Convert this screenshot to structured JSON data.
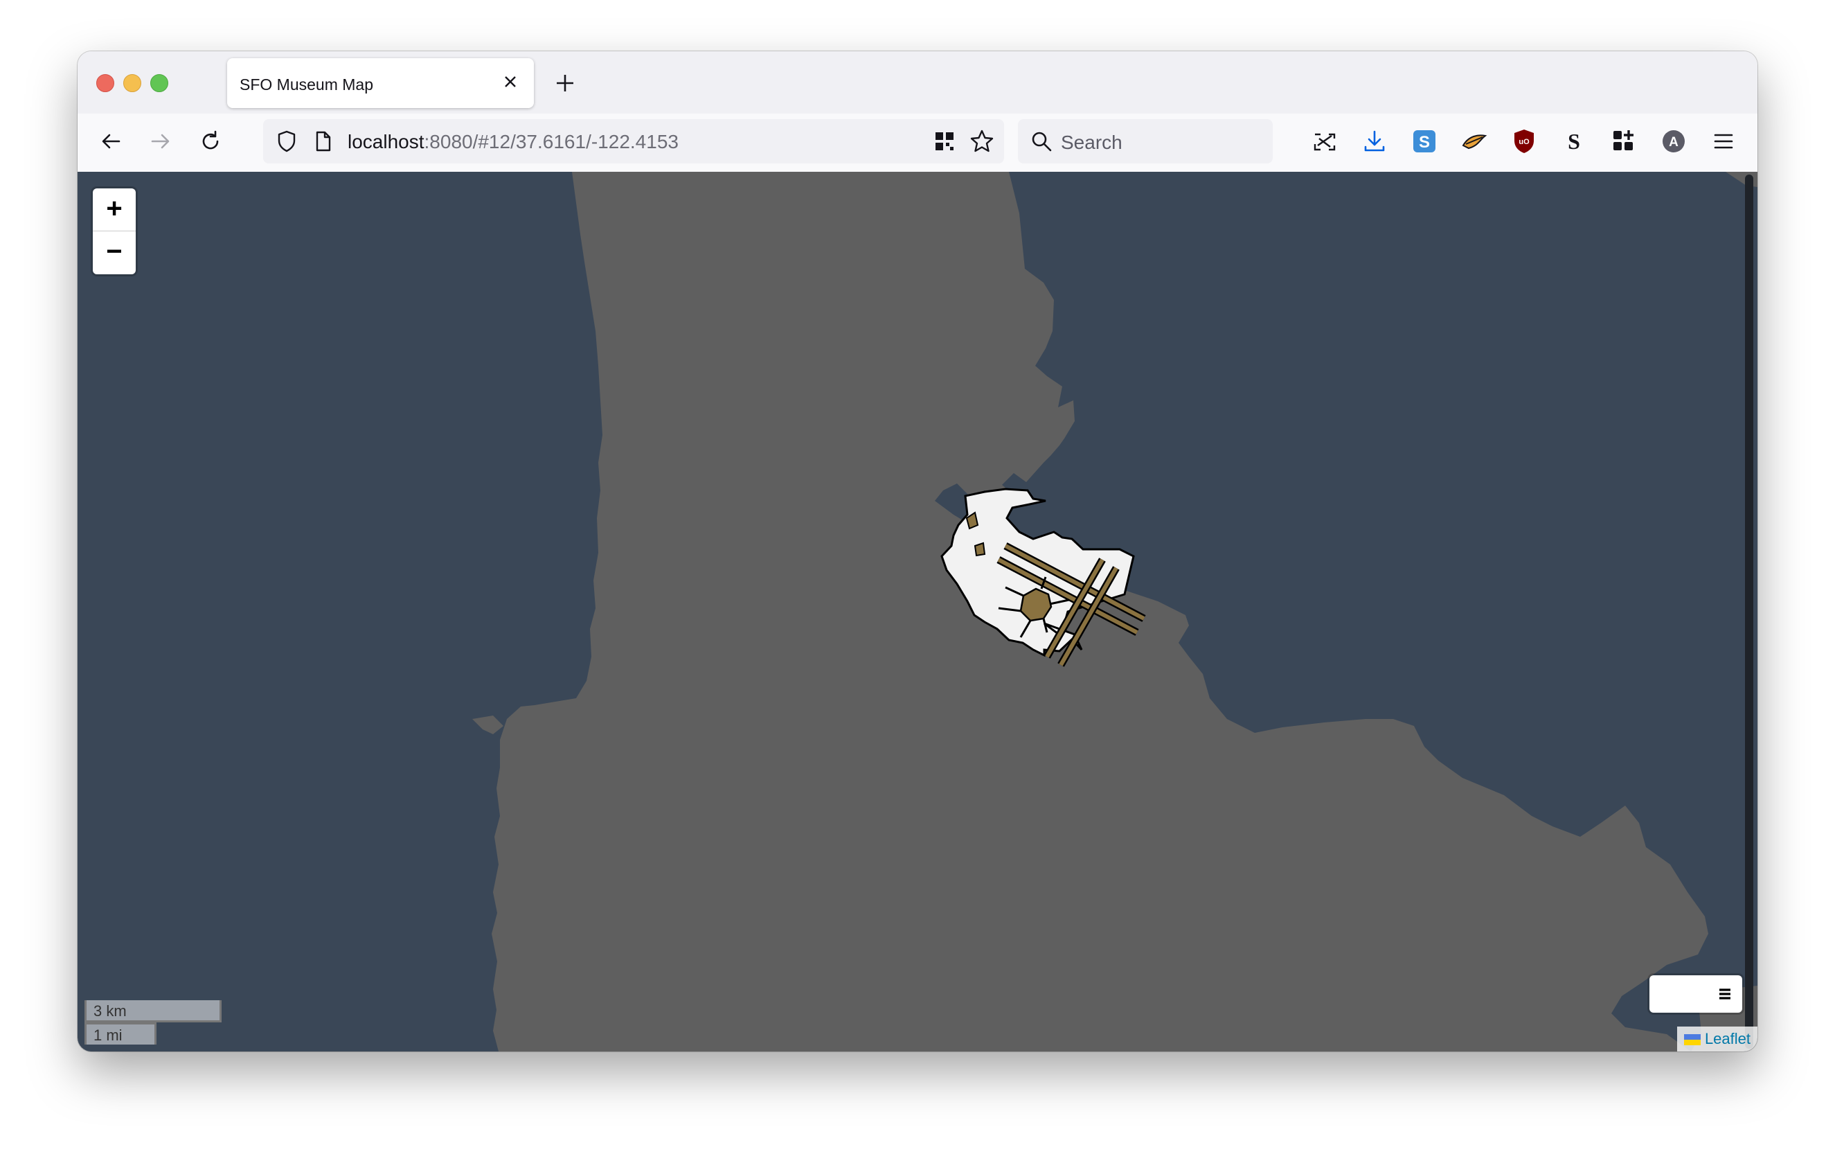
{
  "browser": {
    "tab_title": "SFO Museum Map",
    "url_host": "localhost",
    "url_path": ":8080/#12/37.6161/-122.4153",
    "search_placeholder": "Search"
  },
  "map": {
    "zoom_in_label": "+",
    "zoom_out_label": "−",
    "scale_km": "3 km",
    "scale_mi": "1 mi",
    "attribution": "Leaflet",
    "water_color": "#3a4757",
    "land_color": "#5f5f5f",
    "airport_color": "#f2f2f2",
    "runway_color": "#8a7240"
  },
  "icons": [
    "back-arrow-icon",
    "forward-arrow-icon",
    "reload-icon",
    "shield-icon",
    "page-icon",
    "qr-code-icon",
    "bookmark-star-icon",
    "search-icon",
    "extension-icons",
    "menu-hamburger-icon",
    "layers-icon"
  ]
}
